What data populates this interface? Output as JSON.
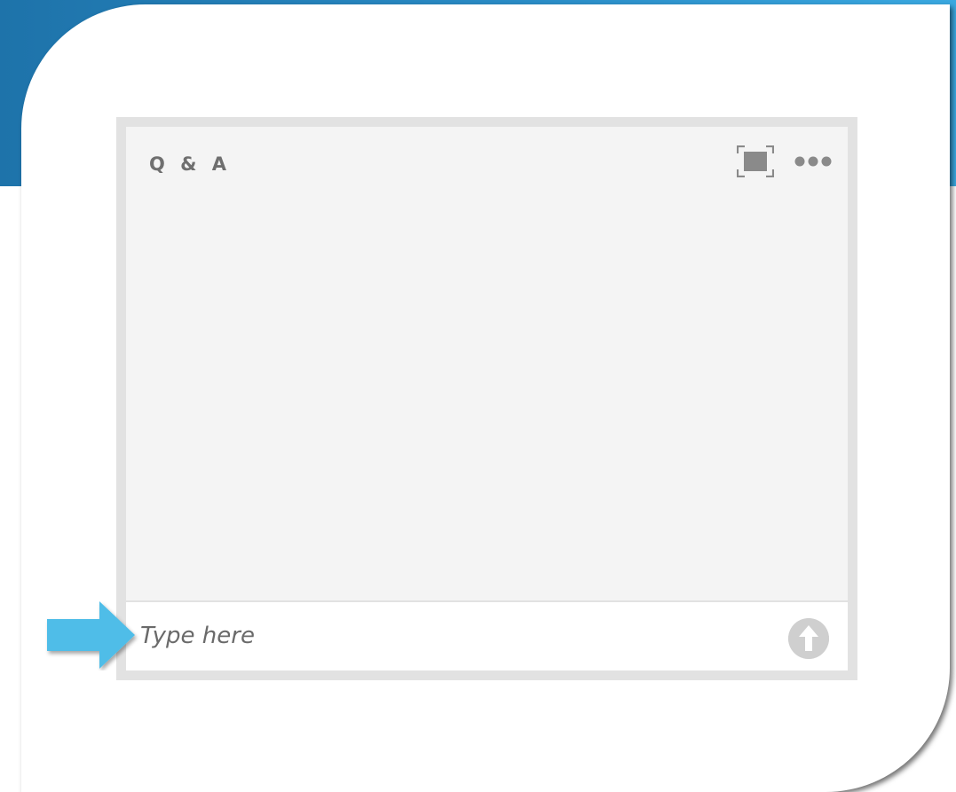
{
  "slide": {
    "banner_color": "#2a8cc6",
    "accent_color": "#4fbde8"
  },
  "qa_pod": {
    "title": "Q & A",
    "fullscreen_icon": "fullscreen-icon",
    "more_icon": "more-options-icon",
    "input_placeholder": "Type here",
    "send_icon": "upload-arrow-icon"
  },
  "annotation": {
    "arrow_icon": "right-arrow-icon"
  }
}
